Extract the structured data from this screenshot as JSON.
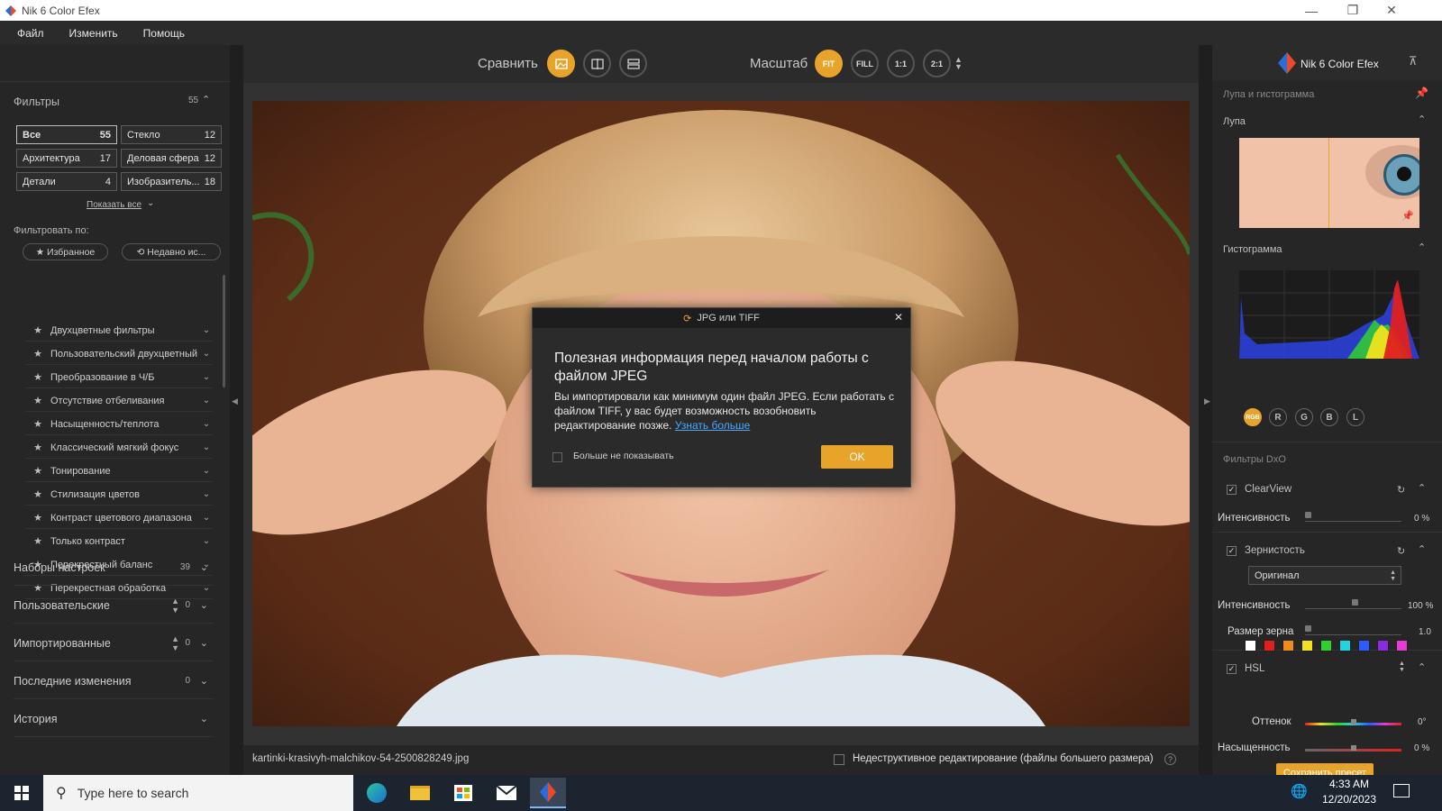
{
  "window": {
    "title": "Nik 6 Color Efex"
  },
  "menu": [
    "Файл",
    "Изменить",
    "Помощь"
  ],
  "left": {
    "filters_title": "Фильтры",
    "filters_count": "55",
    "chips": [
      {
        "label": "Все",
        "count": "55"
      },
      {
        "label": "Стекло",
        "count": "12"
      },
      {
        "label": "Архитектура",
        "count": "17"
      },
      {
        "label": "Деловая сфера",
        "count": "12"
      },
      {
        "label": "Детали",
        "count": "4"
      },
      {
        "label": "Изобразитель...",
        "count": "18"
      }
    ],
    "show_all": "Показать все",
    "filter_by": "Фильтровать по:",
    "favorites": "★ Избранное",
    "recent": "⟲ Недавно ис...",
    "filter_list": [
      "Двухцветные фильтры",
      "Пользовательский двухцветный",
      "Преобразование в Ч/Б",
      "Отсутствие отбеливания",
      "Насыщенность/теплота",
      "Классический мягкий фокус",
      "Тонирование",
      "Стилизация цветов",
      "Контраст цветового диапазона",
      "Только контраст",
      "Перекрестный баланс",
      "Перекрестная обработка"
    ],
    "sections": [
      {
        "label": "Наборы настроек",
        "count": "39"
      },
      {
        "label": "Пользовательские",
        "count": "0"
      },
      {
        "label": "Импортированные",
        "count": "0"
      },
      {
        "label": "Последние изменения",
        "count": "0"
      },
      {
        "label": "История",
        "count": ""
      }
    ]
  },
  "toolbar": {
    "compare": "Сравнить",
    "scale": "Масштаб",
    "fit": "FIT",
    "fill": "FILL",
    "one": "1:1",
    "two": "2:1"
  },
  "status": {
    "filename": "kartinki-krasivyh-malchikov-54-2500828249.jpg",
    "nondestructive": "Недеструктивное редактирование (файлы большего размера)"
  },
  "dialog": {
    "title": "JPG или TIFF",
    "heading": "Полезная информация перед началом работы с файлом JPEG",
    "body": "Вы импортировали как минимум один файл JPEG. Если работать с файлом TIFF, у вас будет возможность возобновить редактирование позже.",
    "link": "Узнать больше",
    "dont_show": "Больше не показывать",
    "ok": "OK"
  },
  "right": {
    "brand": "Nik 6 Color Efex",
    "loupe_histogram": "Лупа и гистограмма",
    "loupe": "Лупа",
    "histogram": "Гистограмма",
    "hist_buttons": [
      "RGB",
      "R",
      "G",
      "B",
      "L"
    ],
    "dxo_filters": "Фильтры DxO",
    "clearview": "ClearView",
    "intensity": "Интенсивность",
    "clearview_intensity": "0 %",
    "grain": "Зернистость",
    "grain_mode": "Оригинал",
    "grain_intensity": "100 %",
    "grain_size_label": "Размер зерна",
    "grain_size": "1.0",
    "hsl": "HSL",
    "hue": "Оттенок",
    "hue_value": "0°",
    "saturation": "Насыщенность",
    "saturation_value": "0 %",
    "save_preset": "Сохранить пресет",
    "hsl_colors": [
      "#ffffff",
      "#e02020",
      "#f08a1c",
      "#f0e21c",
      "#2fd12f",
      "#1fd6e0",
      "#2a5cff",
      "#8a2be2",
      "#e83ad4"
    ]
  },
  "taskbar": {
    "search_placeholder": "Type here to search",
    "time": "4:33 AM",
    "date": "12/20/2023"
  },
  "accent": "#e8a42a"
}
